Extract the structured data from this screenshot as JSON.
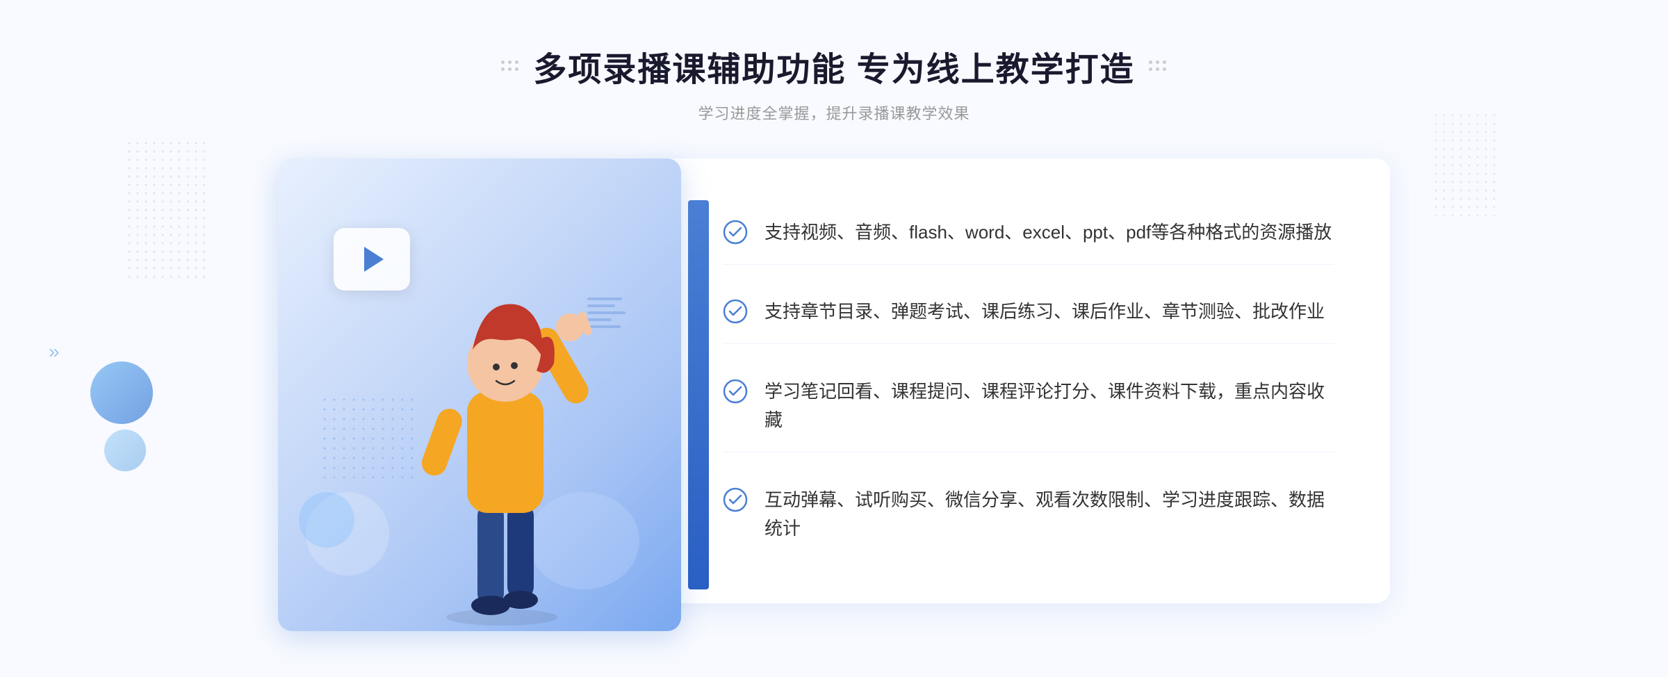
{
  "header": {
    "main_title": "多项录播课辅助功能 专为线上教学打造",
    "subtitle": "学习进度全掌握，提升录播课教学效果"
  },
  "features": [
    {
      "id": 1,
      "text": "支持视频、音频、flash、word、excel、ppt、pdf等各种格式的资源播放"
    },
    {
      "id": 2,
      "text": "支持章节目录、弹题考试、课后练习、课后作业、章节测验、批改作业"
    },
    {
      "id": 3,
      "text": "学习笔记回看、课程提问、课程评论打分、课件资料下载，重点内容收藏"
    },
    {
      "id": 4,
      "text": "互动弹幕、试听购买、微信分享、观看次数限制、学习进度跟踪、数据统计"
    }
  ],
  "decoration": {
    "arrow_char": "»",
    "play_button_label": "play"
  }
}
